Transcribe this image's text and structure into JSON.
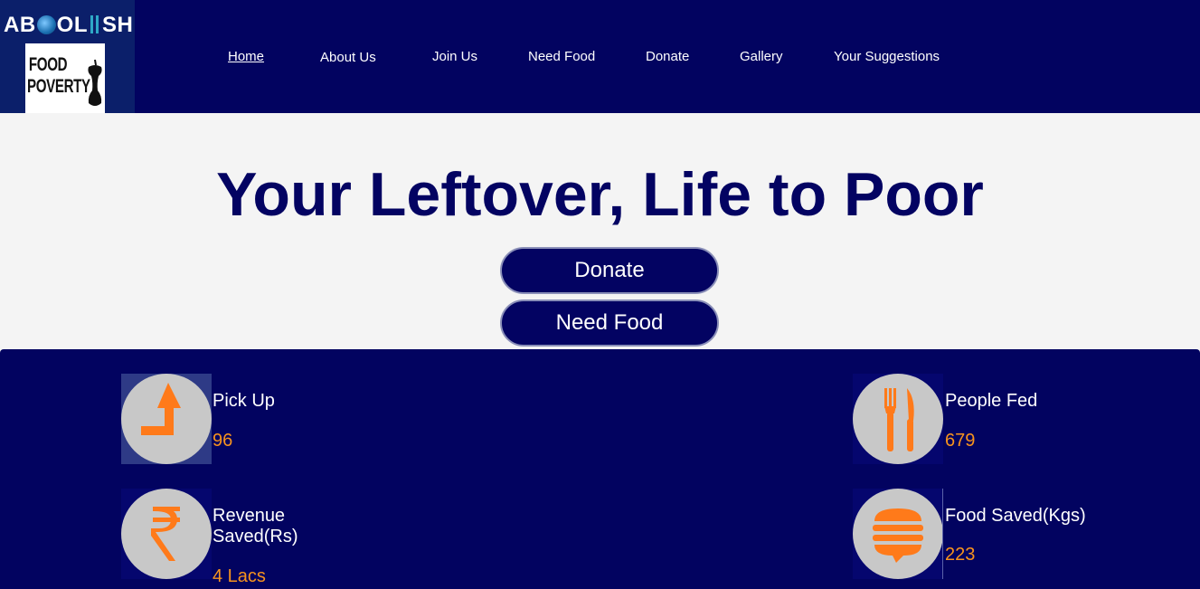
{
  "brand": {
    "logo_part1": "AB",
    "logo_part2": "OL",
    "logo_part3": "SH",
    "poster_line1": "FOOD",
    "poster_line2": "POVERTY"
  },
  "nav": {
    "items": [
      {
        "label": "Home",
        "active": true
      },
      {
        "label": "About Us"
      },
      {
        "label": "Join Us"
      },
      {
        "label": "Need Food"
      },
      {
        "label": "Donate"
      },
      {
        "label": "Gallery"
      },
      {
        "label": "Your Suggestions"
      }
    ]
  },
  "hero": {
    "title": "Your Leftover, Life to Poor",
    "donate_label": "Donate",
    "need_food_label": "Need Food"
  },
  "stats": [
    {
      "label": "Pick Up",
      "value": "96",
      "icon": "pickup-arrow-icon"
    },
    {
      "label": "People Fed",
      "value": "679",
      "icon": "fork-knife-icon"
    },
    {
      "label": "Revenue Saved(Rs)",
      "value": "4 Lacs",
      "icon": "rupee-icon"
    },
    {
      "label": "Food Saved(Kgs)",
      "value": "223",
      "icon": "burger-icon"
    }
  ],
  "colors": {
    "navy": "#020360",
    "accent_orange": "#f7931e",
    "icon_orange": "#ff7a1a",
    "icon_circle": "#c8c8c8",
    "hero_bg": "#f4f4f4"
  }
}
